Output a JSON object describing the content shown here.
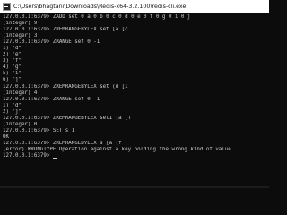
{
  "window": {
    "title": "C:\\Users\\bhagtani\\Downloads\\Redis-x64-3.2.100\\redis-cli.exe"
  },
  "terminal": {
    "lines": [
      "127.0.0.1:6379> ZADD set 0 a 0 b 0 c 0 d 0 e 0 f 0 g 0 i 0 j",
      "(integer) 9",
      "127.0.0.1:6379> ZREMRANGEBYLEX set [a [c",
      "(integer) 3",
      "127.0.0.1:6379> ZRANGE set 0 -1",
      "1) \"d\"",
      "2) \"e\"",
      "3) \"f\"",
      "4) \"g\"",
      "5) \"i\"",
      "6) \"j\"",
      "127.0.0.1:6379> ZREMRANGEBYLEX set (d [i",
      "(integer) 4",
      "127.0.0.1:6379> ZRANGE set 0 -1",
      "1) \"d\"",
      "2) \"j\"",
      "127.0.0.1:6379> ZREMRANGEBYLEX set1 [a [f",
      "(integer) 0",
      "127.0.0.1:6379> SET s 1",
      "OK",
      "127.0.0.1:6379> ZREMRANGEBYLEX s [a [f",
      "(error) WRONGTYPE Operation against a key holding the wrong kind of value"
    ],
    "prompt": "127.0.0.1:6379> "
  },
  "colors": {
    "background": "#0c0c0c",
    "text": "#cccccc",
    "titlebar": "#ffffff"
  },
  "icons": {
    "app": "terminal-icon"
  }
}
